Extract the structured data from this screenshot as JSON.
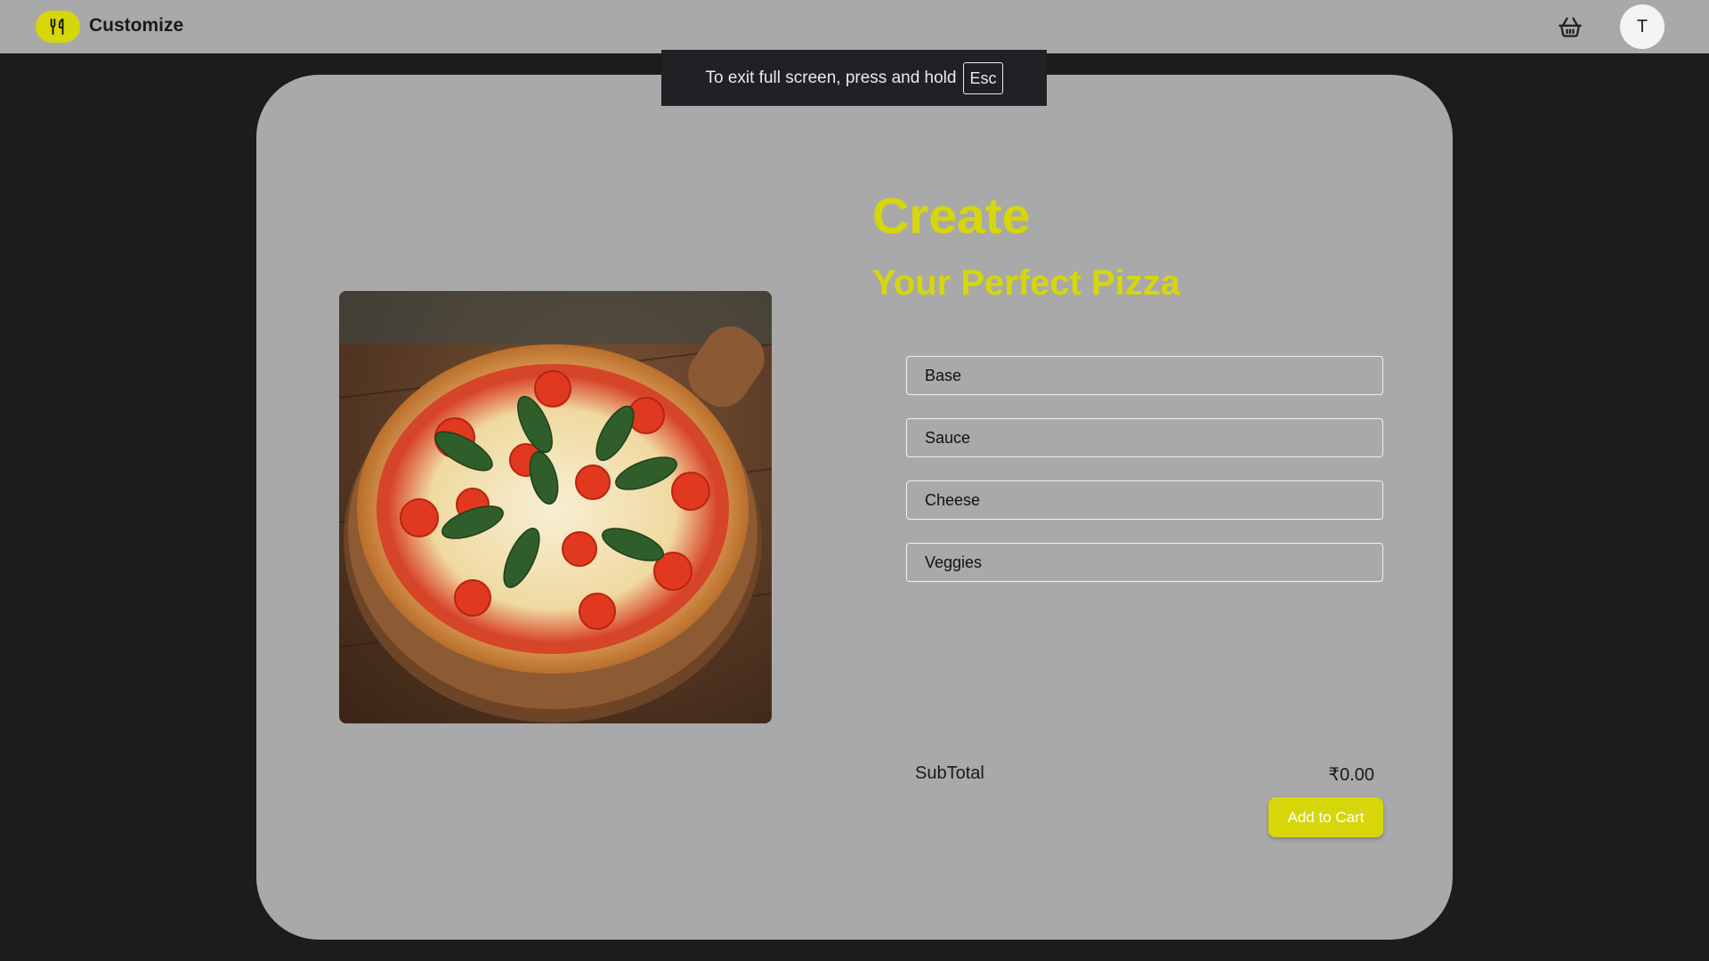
{
  "header": {
    "title": "Customize",
    "logo_icon": "fork-knife-icon",
    "cart_icon": "basket-icon",
    "avatar_initial": "T"
  },
  "fullscreen_notice": {
    "message": "To exit full screen, press and hold",
    "key": "Esc"
  },
  "main": {
    "heading": "Create",
    "subheading": "Your Perfect Pizza",
    "image": "pizza-image",
    "options": [
      {
        "label": "Base"
      },
      {
        "label": "Sauce"
      },
      {
        "label": "Cheese"
      },
      {
        "label": "Veggies"
      }
    ],
    "subtotal_label": "SubTotal",
    "subtotal_value": "₹0.00",
    "add_to_cart_label": "Add to Cart"
  },
  "colors": {
    "accent": "#d6d60a",
    "surface": "#a9a9a9",
    "background": "#1c1c1c",
    "toast": "#202124"
  }
}
